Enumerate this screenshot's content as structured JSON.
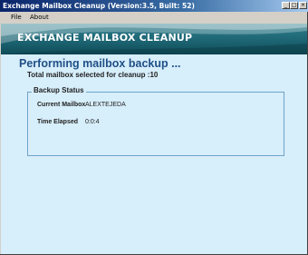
{
  "window": {
    "title": "Exchange Mailbox Cleanup (Version:3.5, Built: 52)",
    "controls": {
      "minimize": "_",
      "maximize": "□",
      "close": "×"
    }
  },
  "menu": {
    "items": [
      "File",
      "About"
    ]
  },
  "banner": {
    "title": "EXCHANGE MAILBOX CLEANUP"
  },
  "main": {
    "heading": "Performing mailbox backup ...",
    "subheading": "Total mailbox selected for cleanup :10"
  },
  "backup_status": {
    "legend": "Backup Status",
    "fields": [
      {
        "label": "Current Mailbox",
        "value": "ALEXTEJEDA"
      },
      {
        "label": "Time Elapsed",
        "value": "0:0:4"
      }
    ]
  },
  "colors": {
    "client_background": "#d7eefb",
    "banner": "#1d6573",
    "heading": "#1f4f86"
  }
}
